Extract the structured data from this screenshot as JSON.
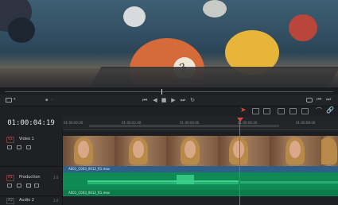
{
  "timecode": "01:00:04:19",
  "ruler": {
    "ticks": [
      "01:00:00:00",
      "01:00:02:00",
      "01:00:04:00",
      "01:00:06:00",
      "01:00:08:00"
    ]
  },
  "transport": {
    "prev_marker": "⏮",
    "step_back": "◀",
    "stop": "■",
    "play": "▶",
    "next_marker": "⏭",
    "loop": "↻"
  },
  "tracks": {
    "video1": {
      "id": "V1",
      "name": "Video 1"
    },
    "audio1": {
      "id": "A1",
      "name": "Production",
      "level": "2.0"
    },
    "audio2": {
      "id": "A2",
      "name": "Audio 2",
      "level": "2.0"
    }
  },
  "clips": {
    "video_label": "A001_C003_0612_R1.mov",
    "audio_label": "A001_C003_0612_R1.mov"
  },
  "colors": {
    "accent": "#e0463c",
    "video_clip": "#2f5e86",
    "audio_clip": "#0f8a55"
  }
}
